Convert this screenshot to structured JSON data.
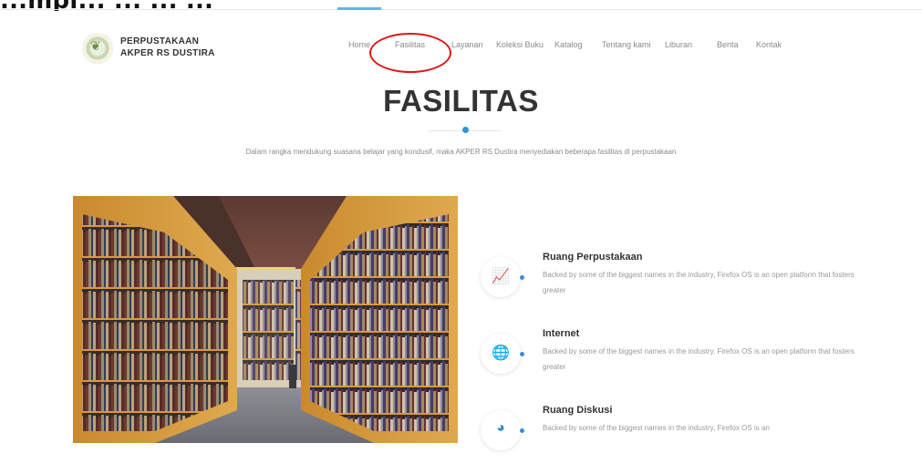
{
  "caption": "...mpi... ... ... ...",
  "site": {
    "brand_line1": "PERPUSTAKAAN",
    "brand_line2": "AKPER RS DUSTIRA"
  },
  "nav": {
    "items": [
      "Home",
      "Fasilitas",
      "Layanan",
      "Koleksi Buku",
      "Katalog",
      "Tentang kami",
      "Liburan",
      "Berita",
      "Kontak"
    ]
  },
  "section": {
    "title": "FASILITAS",
    "subtitle": "Dalam rangka mendukung suasana belajar yang kondusif, maka AKPER RS Dustira menyediakan beberapa fasilitas di perpustakaan"
  },
  "features": [
    {
      "title": "Ruang Perpustakaan",
      "desc": "Backed by some of the biggest names in the industry, Firefox OS is an open platform that fosters greater",
      "icon": "chart-line-icon"
    },
    {
      "title": "Internet",
      "desc": "Backed by some of the biggest names in the industry, Firefox OS is an open platform that fosters greater",
      "icon": "globe-network-icon"
    },
    {
      "title": "Ruang Diskusi",
      "desc": "Backed by some of the biggest names in the industry, Firefox OS is an",
      "icon": "pie-chart-icon"
    }
  ],
  "colors": {
    "accent": "#2e97d4",
    "highlight_circle": "#e01818"
  }
}
